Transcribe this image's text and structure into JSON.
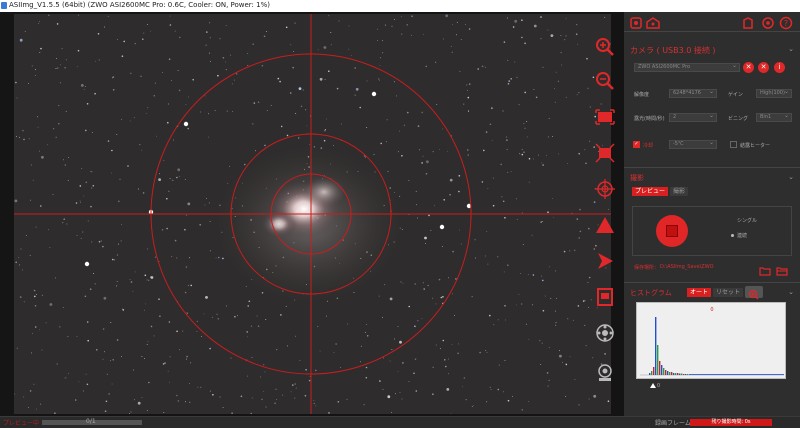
{
  "window": {
    "title": "ASIImg_V1.5.5 (64bit)  (ZWO ASI2600MC Pro: 0.6C, Cooler: ON, Power: 1%)"
  },
  "colors": {
    "accent": "#e0282a",
    "panel_bg": "#2e2e2e",
    "crosshair": "#c81e1e"
  },
  "viewer": {
    "toolbar_icons": [
      "zoom-in-icon",
      "zoom-out-icon",
      "fit-window-icon",
      "actual-size-icon",
      "crosshair-icon",
      "warning-triangle-icon",
      "play-icon",
      "frame-icon",
      "rotate-icon",
      "stack-icon"
    ]
  },
  "panel": {
    "camera_section": {
      "title": "カメラ ( USB3.0 接続 )",
      "camera_select": "ZWO ASI2600MC Pro",
      "resolution_label": "解像度",
      "resolution_value": "6248*4176",
      "gain_label": "ゲイン",
      "gain_value": "High(100)",
      "exposure_label": "露光(時間/秒)",
      "exposure_value": "2",
      "binning_label": "ビニング",
      "binning_value": "Bin1",
      "cooling_label": "冷却",
      "cooling_value": "-5℃",
      "anti_dew_label": "結露ヒーター"
    },
    "capture_section": {
      "title": "撮影",
      "tab_preview": "プレビュー",
      "tab_capture": "撮影",
      "mode_single": "シングル",
      "mode_continuous": "連続",
      "save_path_label": "保存場所：",
      "save_path": "D:\\ASIImg_Save\\ZWO"
    },
    "histogram_section": {
      "title": "ヒストグラム",
      "auto_button": "オート",
      "reset_button": "リセット",
      "chart_caption": "0",
      "marker_label": "0"
    }
  },
  "statusbar": {
    "left_text": "プレビュー中",
    "progress_text": "0/1",
    "record_label": "録画フレーム数",
    "remaining_text": "残り撮影時間: 0s"
  }
}
